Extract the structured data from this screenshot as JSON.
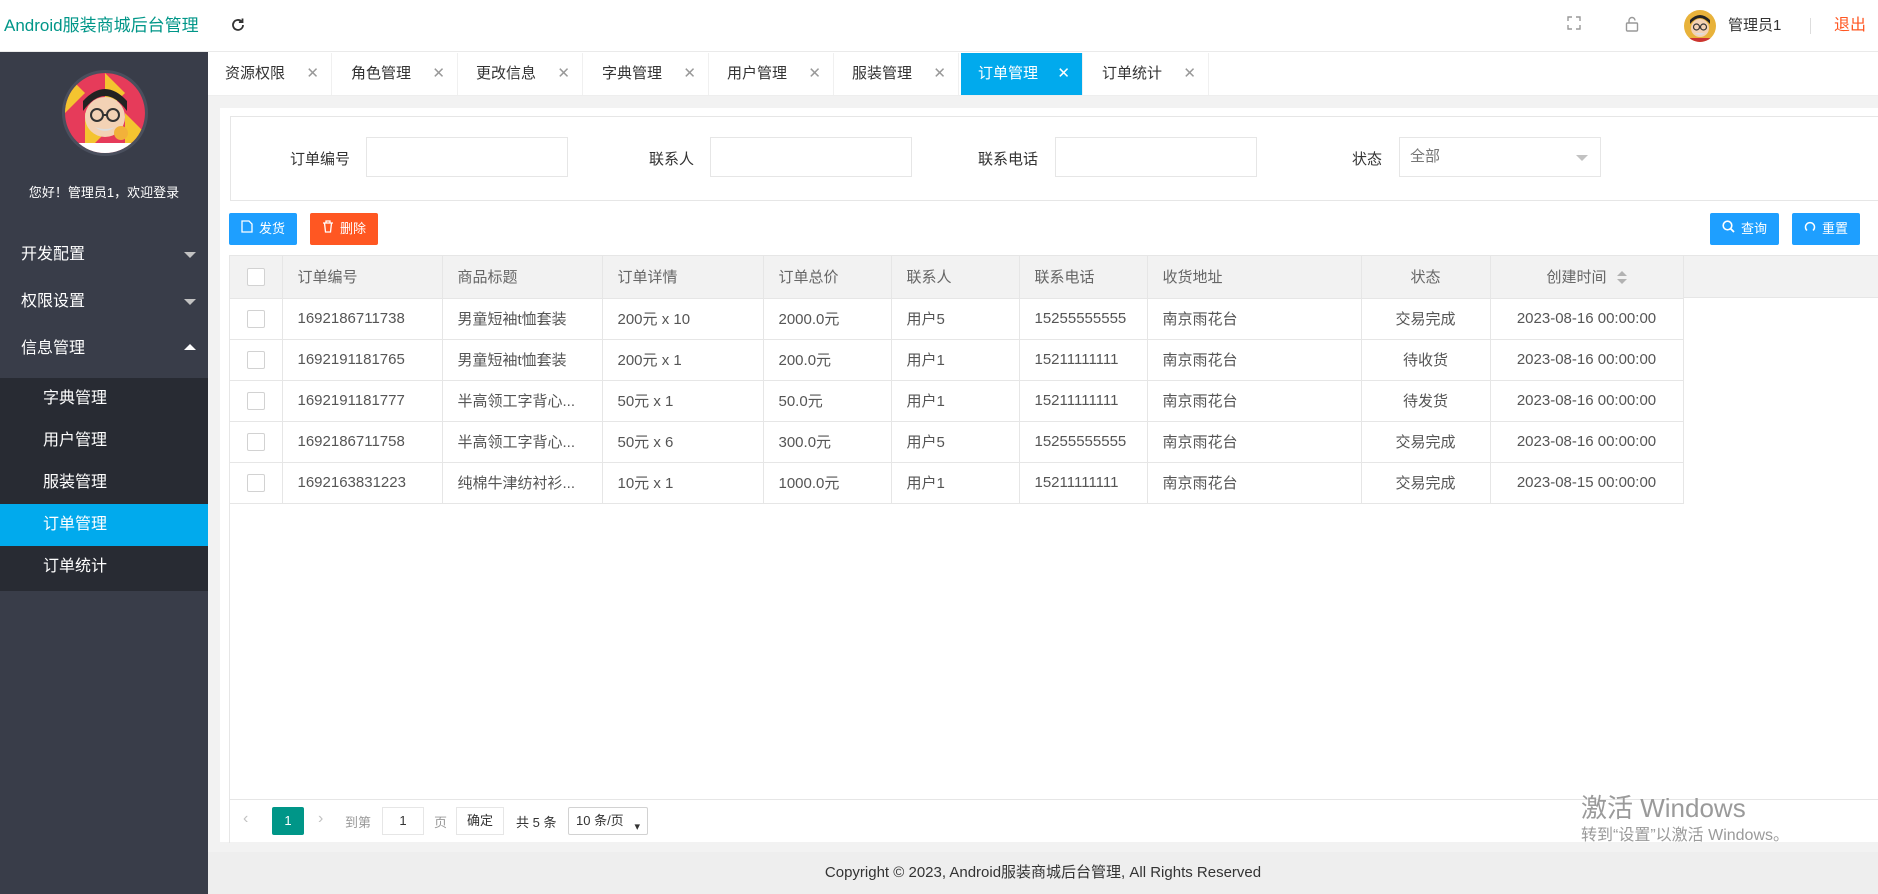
{
  "header": {
    "app_title": "Android服装商城后台管理",
    "user_name": "管理员1",
    "logout_label": "退出"
  },
  "sidebar": {
    "welcome": "您好！管理员1，欢迎登录",
    "groups": [
      {
        "label": "开发配置",
        "expanded": false
      },
      {
        "label": "权限设置",
        "expanded": false
      },
      {
        "label": "信息管理",
        "expanded": true
      }
    ],
    "sub_items": [
      {
        "label": "字典管理",
        "active": false
      },
      {
        "label": "用户管理",
        "active": false
      },
      {
        "label": "服装管理",
        "active": false
      },
      {
        "label": "订单管理",
        "active": true
      },
      {
        "label": "订单统计",
        "active": false
      }
    ]
  },
  "tabs": [
    {
      "label": "资源权限",
      "active": false
    },
    {
      "label": "角色管理",
      "active": false
    },
    {
      "label": "更改信息",
      "active": false
    },
    {
      "label": "字典管理",
      "active": false
    },
    {
      "label": "用户管理",
      "active": false
    },
    {
      "label": "服装管理",
      "active": false
    },
    {
      "label": "订单管理",
      "active": true
    },
    {
      "label": "订单统计",
      "active": false
    }
  ],
  "search": {
    "order_no_label": "订单编号",
    "order_no_value": "",
    "contact_label": "联系人",
    "contact_value": "",
    "phone_label": "联系电话",
    "phone_value": "",
    "status_label": "状态",
    "status_selected": "全部"
  },
  "toolbar": {
    "ship_label": "发货",
    "delete_label": "删除",
    "query_label": "查询",
    "reset_label": "重置"
  },
  "table": {
    "columns": [
      "订单编号",
      "商品标题",
      "订单详情",
      "订单总价",
      "联系人",
      "联系电话",
      "收货地址",
      "状态",
      "创建时间"
    ],
    "rows": [
      [
        "1692186711738",
        "男童短袖t恤套装",
        "200元 x 10",
        "2000.0元",
        "用户5",
        "15255555555",
        "南京雨花台",
        "交易完成",
        "2023-08-16 00:00:00"
      ],
      [
        "1692191181765",
        "男童短袖t恤套装",
        "200元 x 1",
        "200.0元",
        "用户1",
        "15211111111",
        "南京雨花台",
        "待收货",
        "2023-08-16 00:00:00"
      ],
      [
        "1692191181777",
        "半高领工字背心...",
        "50元 x 1",
        "50.0元",
        "用户1",
        "15211111111",
        "南京雨花台",
        "待发货",
        "2023-08-16 00:00:00"
      ],
      [
        "1692186711758",
        "半高领工字背心...",
        "50元 x 6",
        "300.0元",
        "用户5",
        "15255555555",
        "南京雨花台",
        "交易完成",
        "2023-08-16 00:00:00"
      ],
      [
        "1692163831223",
        "纯棉牛津纺衬衫...",
        "10元 x 1",
        "1000.0元",
        "用户1",
        "15211111111",
        "南京雨花台",
        "交易完成",
        "2023-08-15 00:00:00"
      ]
    ]
  },
  "pagination": {
    "current_page": "1",
    "goto_label": "到第",
    "goto_value": "1",
    "page_label": "页",
    "confirm_label": "确定",
    "total_label": "共 5 条",
    "page_size": "10 条/页"
  },
  "footer": {
    "copyright": "Copyright © 2023, Android服装商城后台管理, All Rights Reserved"
  },
  "watermark": {
    "line1": "激活 Windows",
    "line2": "转到“设置”以激活 Windows。"
  },
  "colors": {
    "brand": "#009688",
    "accent": "#01aaed",
    "sidebar_bg": "#393d49",
    "primary_button": "#1e9fff",
    "danger_button": "#ff5722"
  }
}
